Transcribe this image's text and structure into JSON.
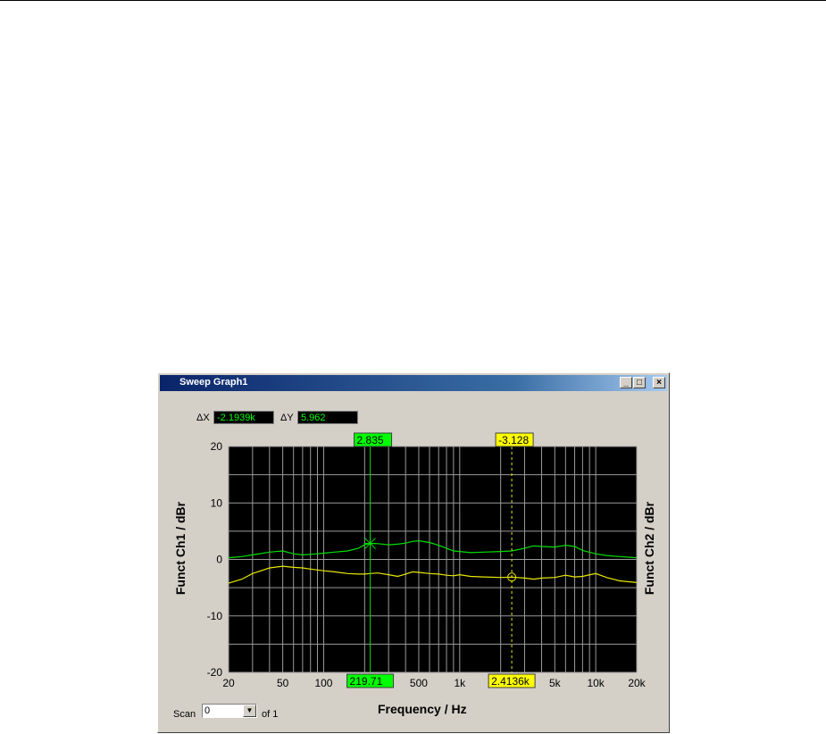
{
  "window": {
    "title": "Sweep Graph1",
    "buttons": {
      "minimize": "_",
      "maximize": "□",
      "close": "×"
    }
  },
  "deltas": {
    "dx_label": "ΔX",
    "dx_value": "-2.1939k",
    "dy_label": "ΔY",
    "dy_value": "5.962"
  },
  "markers": {
    "cursor1_y": "2.835",
    "cursor2_y": "-3.128",
    "cursor1_x": "219.71",
    "cursor2_x": "2.4136k"
  },
  "scan": {
    "label": "Scan",
    "value": "0",
    "of_label": "of 1"
  },
  "colors": {
    "trace1": "#00e000",
    "trace2": "#e8e800",
    "plot_bg": "#000000",
    "grid": "#9a9a9a",
    "green_label_bg": "#00ff00",
    "yellow_label_bg": "#ffff00"
  },
  "chart_data": {
    "type": "line",
    "xscale": "log",
    "xlabel": "Frequency / Hz",
    "ylabel": "Funct Ch1 / dBr",
    "ylabel_right": "Funct Ch2 / dBr",
    "xlim": [
      20,
      20000
    ],
    "ylim": [
      -20,
      20
    ],
    "xticks": [
      20,
      50,
      100,
      200,
      500,
      1000,
      2000,
      5000,
      10000,
      20000
    ],
    "xtick_labels": [
      "20",
      "50",
      "100",
      "",
      "500",
      "1k",
      "",
      "5k",
      "10k",
      "20k"
    ],
    "yticks": [
      20,
      10,
      0,
      -10,
      -20
    ],
    "ytick_labels": [
      "20",
      "10",
      "0",
      "-10",
      "-20"
    ],
    "grid": true,
    "cursors": [
      {
        "x": 219.71,
        "y": 2.835,
        "style": "solid",
        "series": 0
      },
      {
        "x": 2413.6,
        "y": -3.128,
        "style": "dashed",
        "series": 1
      }
    ],
    "series": [
      {
        "x": [
          20,
          25,
          30,
          40,
          50,
          60,
          70,
          80,
          100,
          120,
          150,
          180,
          200,
          219.71,
          250,
          300,
          350,
          400,
          450,
          500,
          600,
          700,
          800,
          900,
          1000,
          1200,
          1500,
          2000,
          2413.6,
          3000,
          3500,
          4000,
          5000,
          6000,
          7000,
          8000,
          10000,
          12000,
          15000,
          20000
        ],
        "y": [
          0.3,
          0.5,
          0.8,
          1.3,
          1.5,
          1.0,
          0.8,
          0.9,
          1.1,
          1.3,
          1.5,
          2.0,
          2.6,
          2.835,
          2.8,
          2.6,
          2.7,
          2.9,
          3.2,
          3.3,
          3.0,
          2.5,
          2.0,
          1.5,
          1.4,
          1.2,
          1.3,
          1.4,
          1.5,
          2.0,
          2.4,
          2.3,
          2.2,
          2.5,
          2.3,
          1.6,
          1.0,
          0.7,
          0.5,
          0.3
        ]
      },
      {
        "x": [
          20,
          25,
          30,
          40,
          50,
          60,
          70,
          80,
          100,
          120,
          150,
          180,
          200,
          219.71,
          250,
          300,
          350,
          400,
          450,
          500,
          600,
          700,
          800,
          900,
          1000,
          1200,
          1500,
          2000,
          2413.6,
          3000,
          3500,
          4000,
          5000,
          6000,
          7000,
          8000,
          10000,
          12000,
          15000,
          20000
        ],
        "y": [
          -4.2,
          -3.5,
          -2.5,
          -1.5,
          -1.2,
          -1.4,
          -1.5,
          -1.7,
          -2.0,
          -2.2,
          -2.5,
          -2.6,
          -2.6,
          -2.5,
          -2.4,
          -2.7,
          -3.0,
          -2.6,
          -2.2,
          -2.3,
          -2.5,
          -2.6,
          -2.8,
          -2.9,
          -2.7,
          -3.0,
          -3.1,
          -3.2,
          -3.128,
          -3.3,
          -3.5,
          -3.3,
          -3.2,
          -2.8,
          -3.1,
          -3.0,
          -2.5,
          -3.2,
          -3.8,
          -4.1
        ]
      }
    ]
  }
}
